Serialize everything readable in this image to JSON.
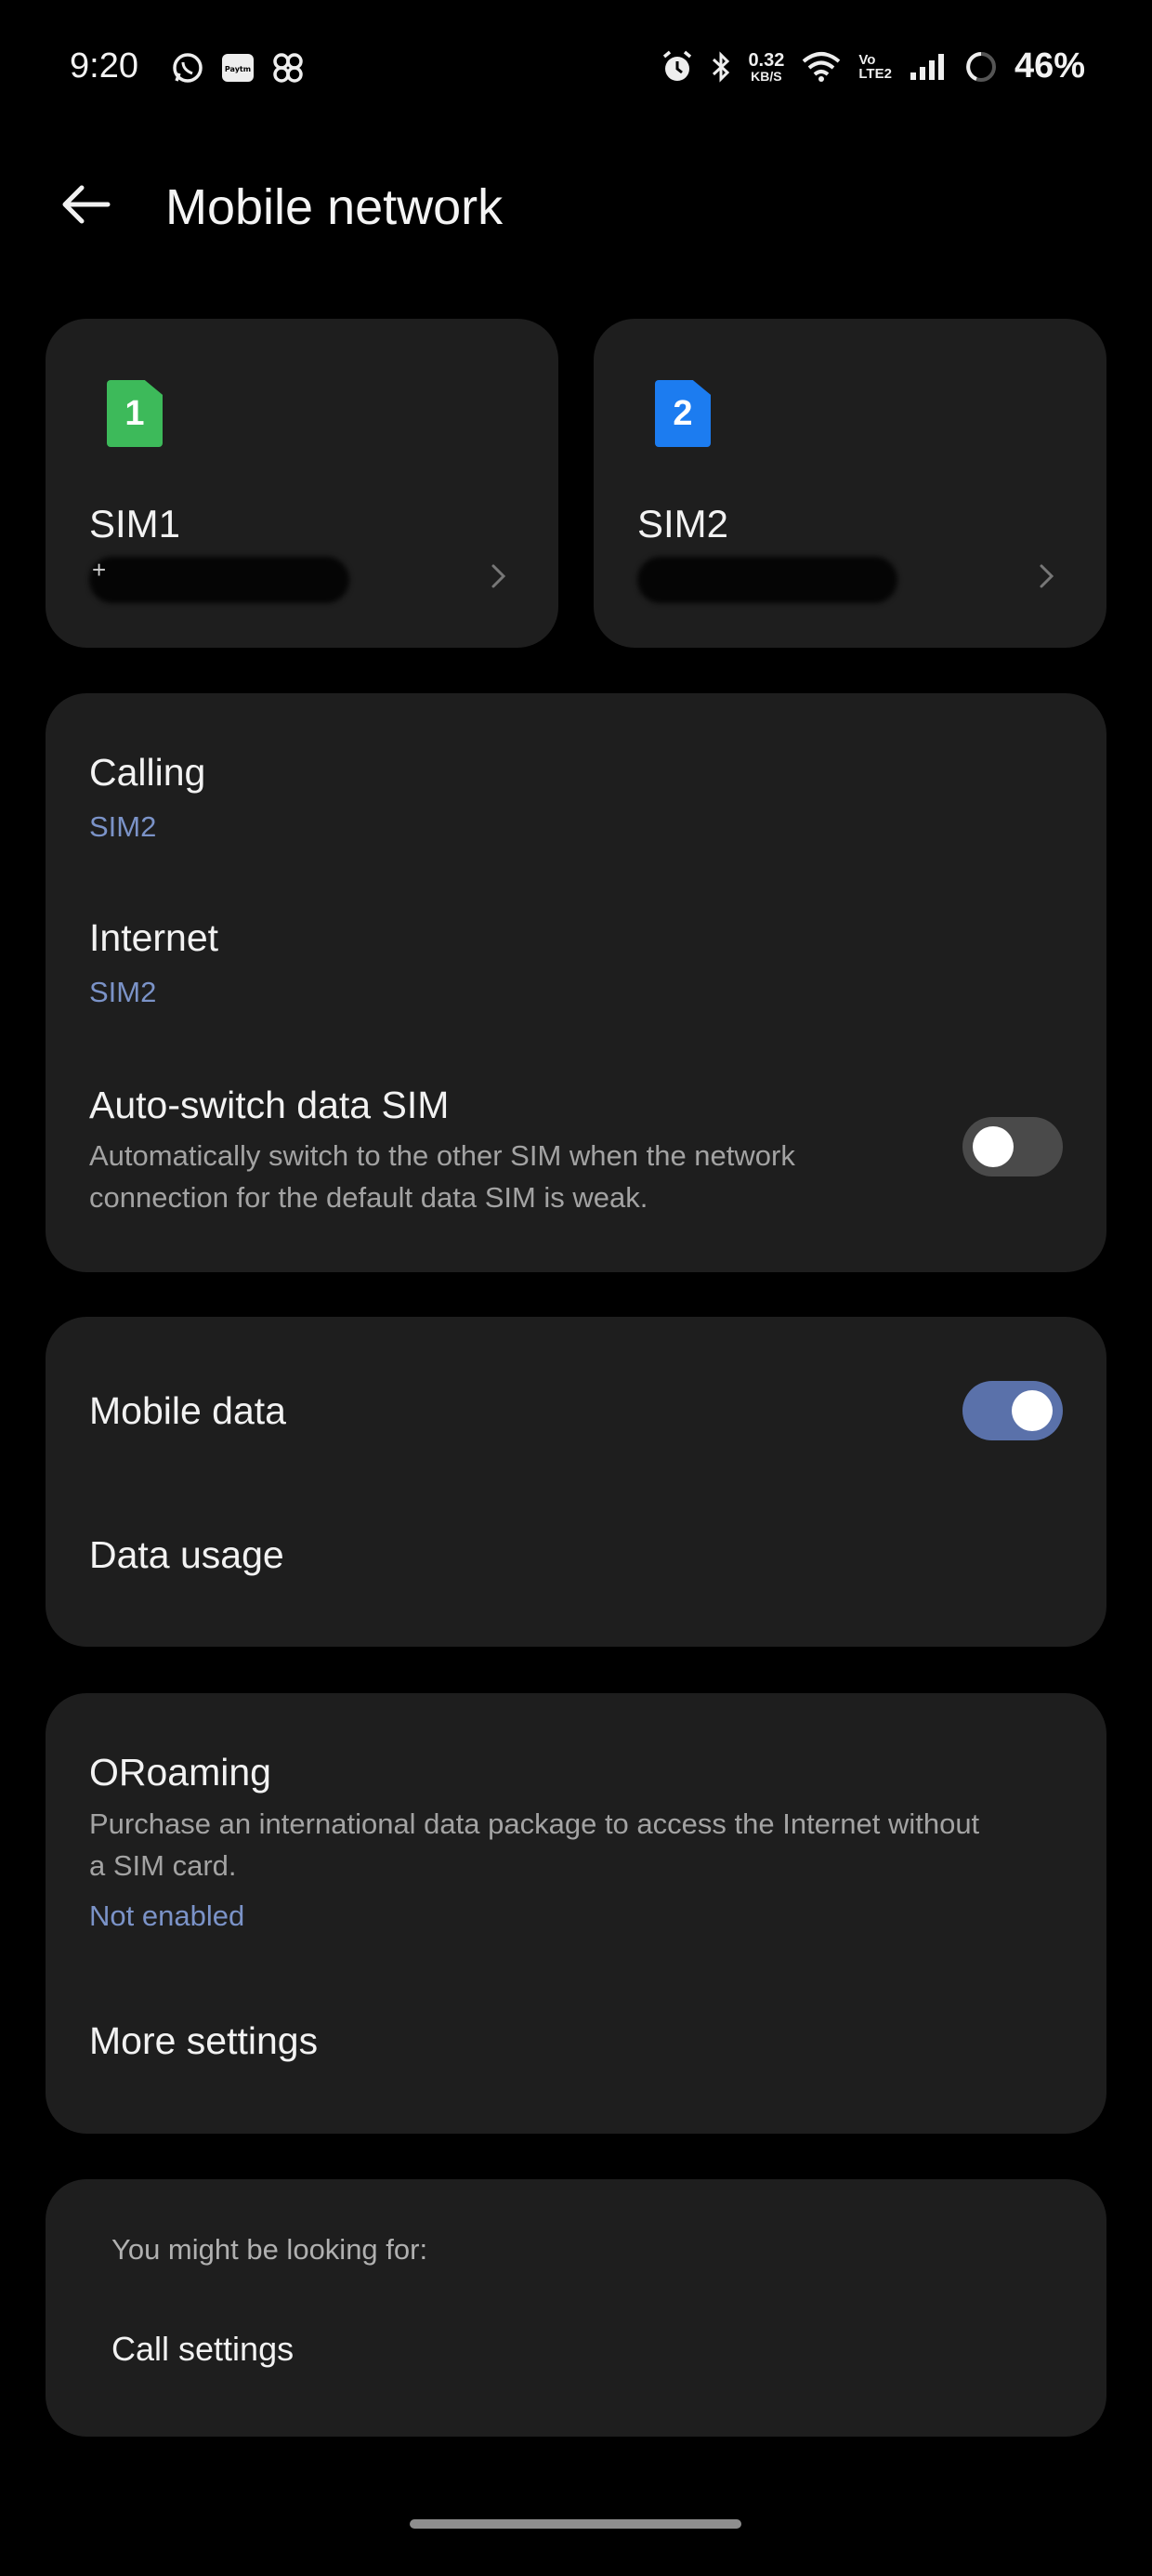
{
  "status_bar": {
    "time": "9:20",
    "left_icons": [
      "whatsapp-icon",
      "paytm-icon",
      "pinwheel-icon"
    ],
    "net_speed_value": "0.32",
    "net_speed_unit": "KB/S",
    "volte_top": "Vo",
    "volte_bottom": "LTE2",
    "battery_percent": "46%"
  },
  "header": {
    "title": "Mobile network"
  },
  "sims": [
    {
      "name": "SIM1",
      "badge": "1",
      "badge_color": "#3DBA5A",
      "number_visible": "+"
    },
    {
      "name": "SIM2",
      "badge": "2",
      "badge_color": "#1C7CF0"
    }
  ],
  "sim_settings": {
    "calling": {
      "title": "Calling",
      "value": "SIM2"
    },
    "internet": {
      "title": "Internet",
      "value": "SIM2"
    },
    "auto_switch": {
      "title": "Auto-switch data SIM",
      "desc_line1": "Automatically switch to the other SIM when the network",
      "desc_line2": "connection for the default data SIM is weak.",
      "enabled": false
    }
  },
  "data_section": {
    "mobile_data": {
      "title": "Mobile data",
      "enabled": true
    },
    "data_usage": {
      "title": "Data usage"
    }
  },
  "roaming_section": {
    "oroaming": {
      "title": "ORoaming",
      "desc_line1": "Purchase an international data package to access the Internet without",
      "desc_line2": "a SIM card.",
      "status": "Not enabled"
    },
    "more_settings": {
      "title": "More settings"
    }
  },
  "suggestions": {
    "heading": "You might be looking for:",
    "items": [
      "Call settings"
    ]
  },
  "colors": {
    "background": "#000000",
    "card": "#1E1E1E",
    "accent_blue": "#7B93C8",
    "toggle_on": "#5A71AA",
    "toggle_off": "#4A4A4A"
  }
}
